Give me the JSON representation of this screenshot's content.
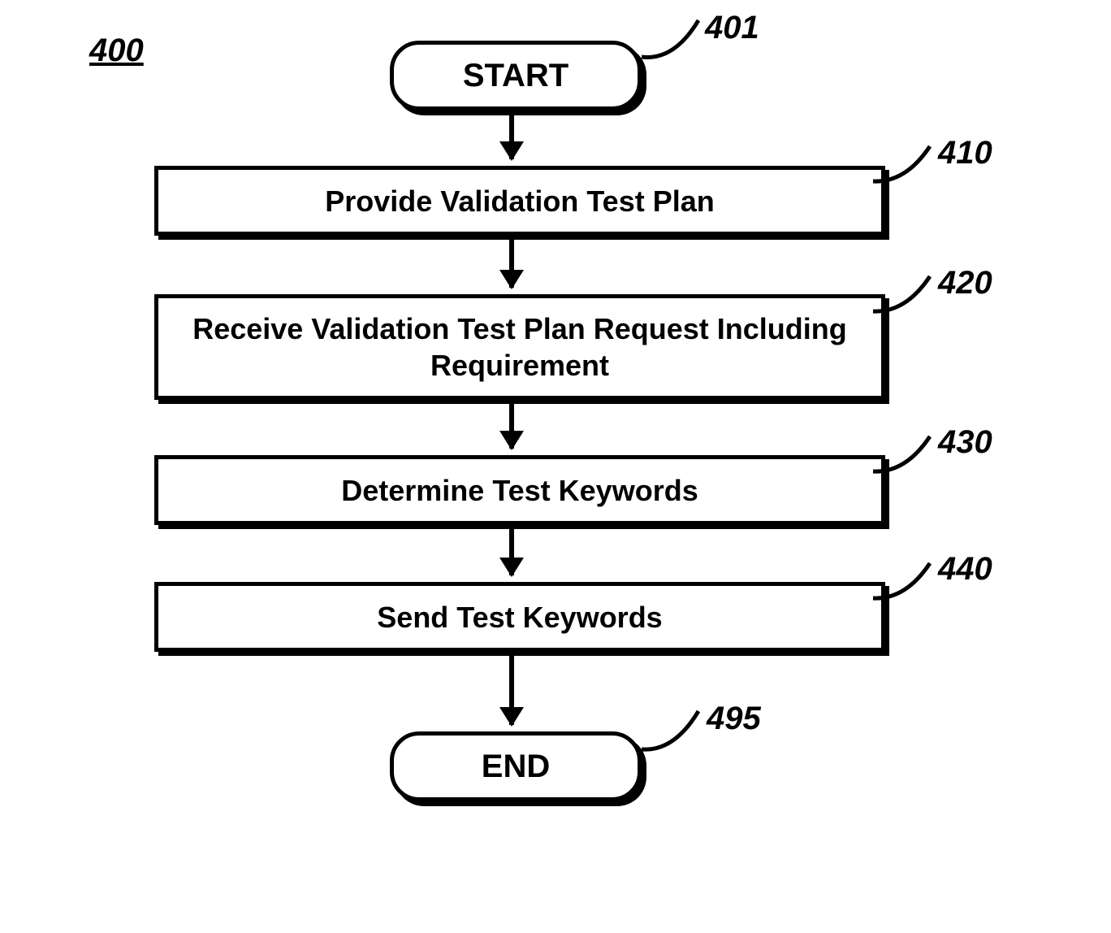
{
  "figure_ref": "400",
  "nodes": {
    "start": {
      "text": "START",
      "ref": "401"
    },
    "step1": {
      "text": "Provide Validation Test Plan",
      "ref": "410"
    },
    "step2": {
      "text": "Receive Validation Test Plan Request Including Requirement",
      "ref": "420"
    },
    "step3": {
      "text": "Determine Test Keywords",
      "ref": "430"
    },
    "step4": {
      "text": "Send Test Keywords",
      "ref": "440"
    },
    "end": {
      "text": "END",
      "ref": "495"
    }
  }
}
